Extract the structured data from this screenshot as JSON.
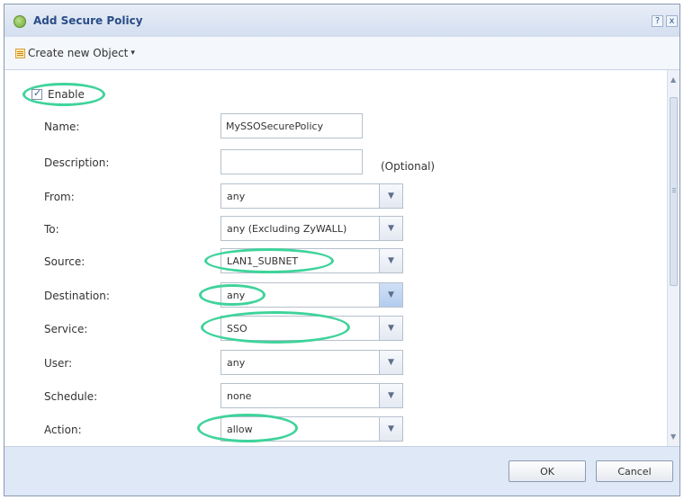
{
  "dialog": {
    "title": "Add Secure Policy",
    "help_label": "?",
    "close_label": "x"
  },
  "toolbar": {
    "create_object_label": "Create new Object"
  },
  "form": {
    "enable": {
      "label": "Enable",
      "checked": true
    },
    "name": {
      "label": "Name:",
      "value": "MySSOSecurePolicy"
    },
    "description": {
      "label": "Description:",
      "value": "",
      "hint": "(Optional)"
    },
    "from": {
      "label": "From:",
      "value": "any"
    },
    "to": {
      "label": "To:",
      "value": "any (Excluding ZyWALL)"
    },
    "source": {
      "label": "Source:",
      "value": "LAN1_SUBNET"
    },
    "destination": {
      "label": "Destination:",
      "value": "any"
    },
    "service": {
      "label": "Service:",
      "value": "SSO"
    },
    "user": {
      "label": "User:",
      "value": "any"
    },
    "schedule": {
      "label": "Schedule:",
      "value": "none"
    },
    "action": {
      "label": "Action:",
      "value": "allow"
    }
  },
  "footer": {
    "ok_label": "OK",
    "cancel_label": "Cancel"
  },
  "colors": {
    "highlight": "#3fd39b",
    "title_text": "#2a4d86",
    "dialog_bg": "#dfe8f6"
  }
}
